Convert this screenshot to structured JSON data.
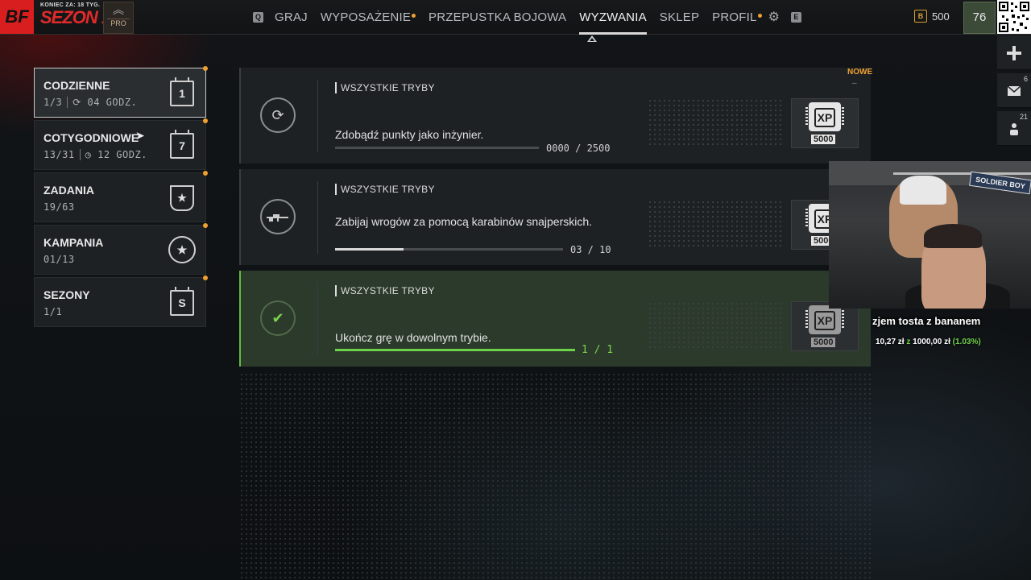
{
  "header": {
    "logo": "BF",
    "season_subtitle": "KONIEC ZA: 18 TYG.",
    "season_title": "SEZON 1.",
    "rank_label": "PRO",
    "key_left": "Q",
    "key_right": "E",
    "nav": [
      {
        "label": "GRAJ",
        "dot": false
      },
      {
        "label": "WYPOSAŻENIE",
        "dot": true
      },
      {
        "label": "PRZEPUSTKA BOJOWA",
        "dot": false
      },
      {
        "label": "WYZWANIA",
        "dot": false,
        "active": true
      },
      {
        "label": "SKLEP",
        "dot": false
      },
      {
        "label": "PROFIL",
        "dot": true
      }
    ],
    "currency_icon": "B",
    "currency_amount": "500",
    "level": "76"
  },
  "side_rail": {
    "items": [
      {
        "icon": "plus-icon",
        "count": ""
      },
      {
        "icon": "mail-icon",
        "count": "6"
      },
      {
        "icon": "friends-icon",
        "count": "21"
      }
    ]
  },
  "categories": [
    {
      "title": "CODZIENNE",
      "progress": "1/3",
      "timer": "04 GODZ.",
      "icon_text": "1",
      "active": true
    },
    {
      "title": "COTYGODNIOWE",
      "progress": "13/31",
      "timer": "12 GODZ.",
      "icon_text": "7"
    },
    {
      "title": "ZADANIA",
      "progress": "19/63",
      "icon_text": "★"
    },
    {
      "title": "KAMPANIA",
      "progress": "01/13",
      "icon_text": "★"
    },
    {
      "title": "SEZONY",
      "progress": "1/1",
      "icon_text": "S"
    }
  ],
  "challenges": [
    {
      "mode": "WSZYSTKIE TRYBY",
      "description": "Zdobądź punkty jako inżynier.",
      "progress_text": "0000 / 2500",
      "progress": 0.0,
      "reward": "XP",
      "reward_amount": "5000",
      "tag": "NOWE",
      "tag_dash": "–",
      "icon": "engineer-icon"
    },
    {
      "mode": "WSZYSTKIE TRYBY",
      "description": "Zabijaj wrogów za pomocą karabinów snajperskich.",
      "progress_text": "03 / 10",
      "progress": 0.3,
      "reward": "XP",
      "reward_amount": "5000",
      "icon": "sniper-rifle-icon"
    },
    {
      "mode": "WSZYSTKIE TRYBY",
      "description": "Ukończ grę w dowolnym trybie.",
      "progress_text": "1 / 1",
      "progress": 1.0,
      "reward": "XP",
      "reward_amount": "5000",
      "completed": true,
      "icon": "checkmark-icon"
    }
  ],
  "overlay": {
    "sign_text": "SOLDIER BOY",
    "donation_title": "zjem tosta z bananem",
    "donation_current": "10,27 zł",
    "donation_sep": "z",
    "donation_goal": "1000,00 zł",
    "donation_pct": "(1.03%)"
  },
  "colors": {
    "accent_orange": "#f0a030",
    "complete_green": "#6fd34a",
    "brand_red": "#d81e1e"
  }
}
